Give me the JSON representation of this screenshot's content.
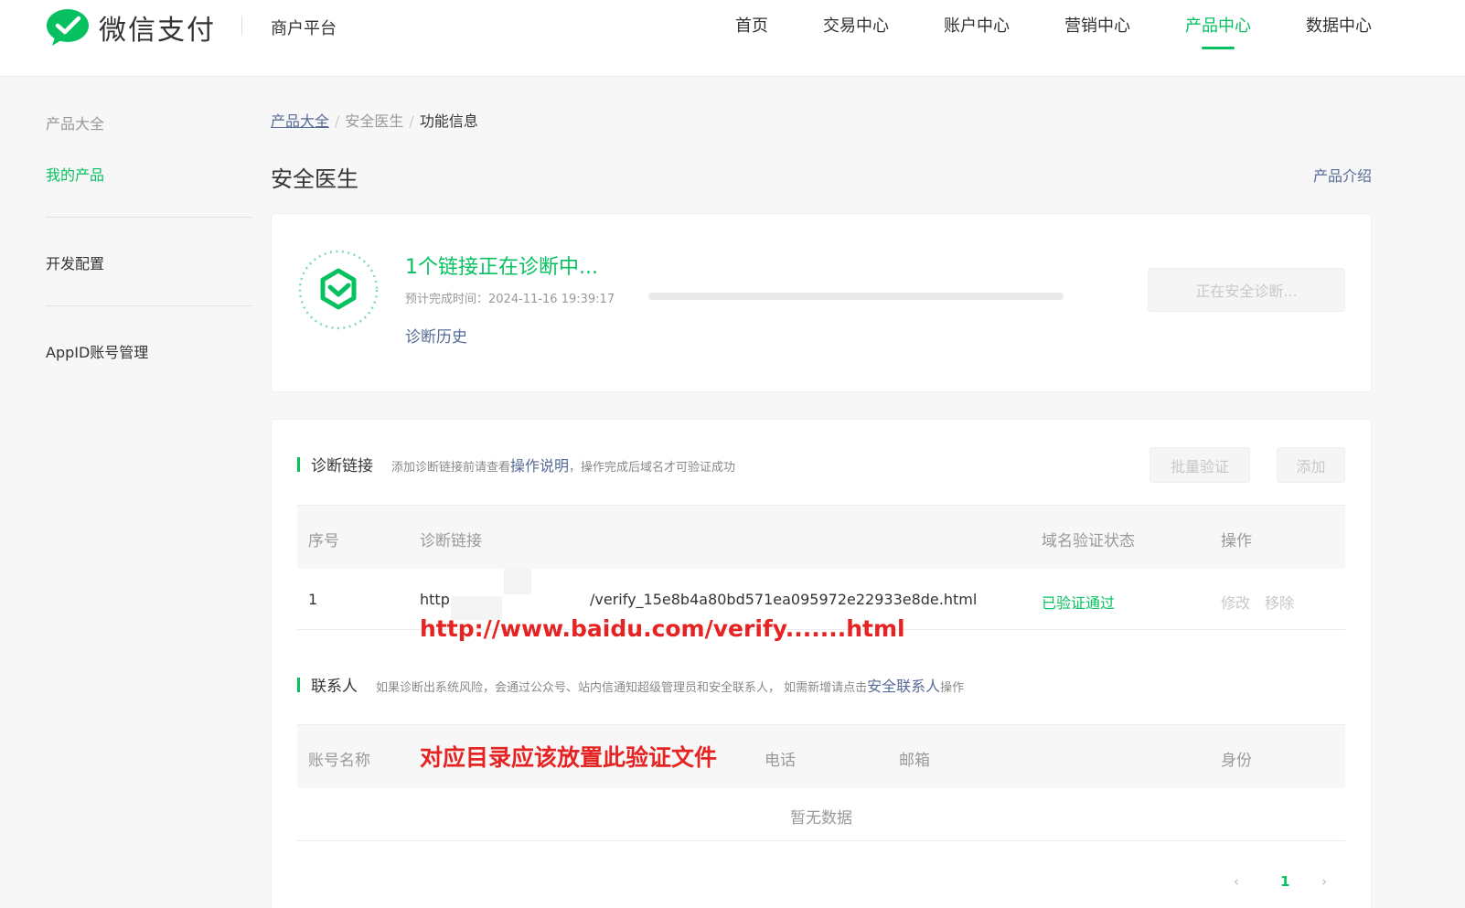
{
  "header": {
    "brand": "微信支付",
    "platform": "商户平台",
    "nav": [
      {
        "label": "首页"
      },
      {
        "label": "交易中心"
      },
      {
        "label": "账户中心"
      },
      {
        "label": "营销中心"
      },
      {
        "label": "产品中心"
      },
      {
        "label": "数据中心"
      }
    ],
    "active_nav": "产品中心"
  },
  "sidebar": {
    "title": "产品大全",
    "items": [
      {
        "label": "我的产品"
      },
      {
        "label": "开发配置"
      },
      {
        "label": "AppID账号管理"
      }
    ]
  },
  "breadcrumb": {
    "items": [
      "产品大全",
      "安全医生",
      "功能信息"
    ],
    "separator": "/"
  },
  "page": {
    "title": "安全医生",
    "intro_link": "产品介绍"
  },
  "diagnosis": {
    "title": "1个链接正在诊断中...",
    "time_label": "预计完成时间：",
    "time_value": "2024-11-16 19:39:17",
    "history_link": "诊断历史",
    "button": "正在安全诊断...",
    "progress": 0.0
  },
  "links_section": {
    "title": "诊断链接",
    "tip_before": "添加诊断链接前请查看",
    "tip_link": "操作说明",
    "tip_after": "，操作完成后域名才可验证成功",
    "batch_button": "批量验证",
    "add_button": "添加",
    "columns": [
      "序号",
      "诊断链接",
      "域名验证状态",
      "操作"
    ],
    "rows": [
      {
        "index": "1",
        "link_prefix": "http:",
        "link_suffix": "/verify_15e8b4a80bd571ea095972e22933e8de.html",
        "status": "已验证通过",
        "ops": [
          "修改",
          "移除"
        ]
      }
    ],
    "annotation": "http://www.baidu.com/verify.......html"
  },
  "contacts_section": {
    "title": "联系人",
    "tip_before": "如果诊断出系统风险，会通过公众号、站内信通知超级管理员和安全联系人， 如需新增请点击",
    "tip_link": "安全联系人",
    "tip_after": "操作",
    "columns": [
      "账号名称",
      "电话",
      "邮箱",
      "身份"
    ],
    "empty_text": "暂无数据",
    "annotation": "对应目录应该放置此验证文件"
  },
  "pagination": {
    "prev": "‹",
    "current": "1",
    "next": "›"
  },
  "colors": {
    "brand_green": "#07c160",
    "link_blue": "#576b95",
    "annotation_red": "#e52323"
  }
}
